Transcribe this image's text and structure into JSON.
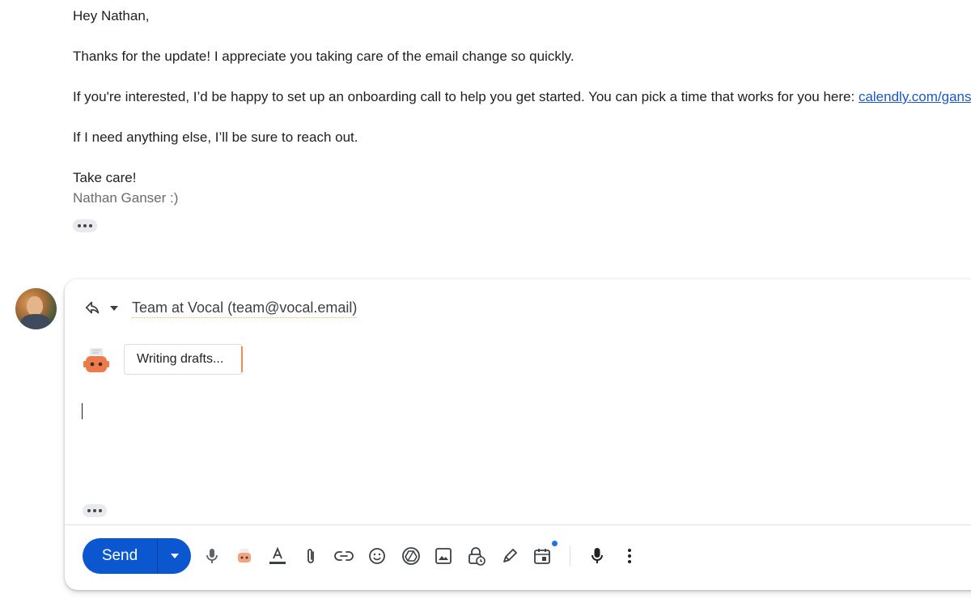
{
  "message": {
    "greeting": "Hey Nathan,",
    "para1": "Thanks for the update! I appreciate you taking care of the email change so quickly.",
    "para2_text": "If you're interested, I’d be happy to set up an onboarding call to help you get started. You can pick a time that works for you here: ",
    "para2_link": "calendly.com/ganser",
    "para2_end": ".",
    "para3": "If I need anything else, I’ll be sure to reach out.",
    "closing": "Take care!",
    "signature": "Nathan Ganser :)"
  },
  "compose": {
    "recipient": "Team at Vocal (team@vocal.email)",
    "draft_status": "Writing drafts...",
    "send_label": "Send"
  },
  "icons": {
    "reply": "reply-icon",
    "dropdown": "chevron-down-icon",
    "assistant": "ai-assistant-icon",
    "more": "more-options-icon"
  },
  "colors": {
    "accent": "#0b57d0",
    "link": "#1a57c8",
    "assistant": "#ec7a4b",
    "notification": "#1a73e8"
  }
}
